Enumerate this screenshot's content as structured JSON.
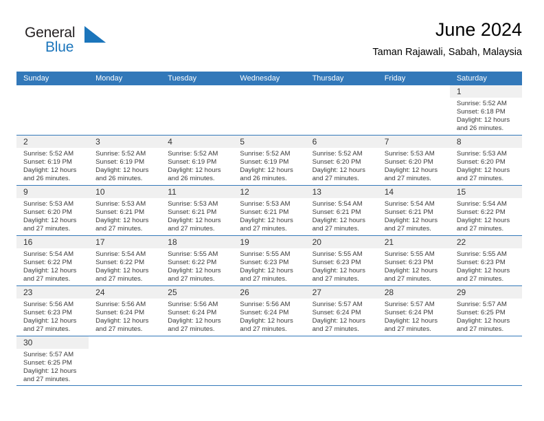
{
  "brand": {
    "name_part1": "General",
    "name_part2": "Blue",
    "mark": "triangle-logo-icon",
    "dark_color": "#231f20",
    "blue_color": "#1b75bb"
  },
  "header": {
    "title": "June 2024",
    "subtitle": "Taman Rajawali, Sabah, Malaysia"
  },
  "theme": {
    "header_blue": "#3278b9",
    "daynum_band": "#f0f0f0",
    "text": "#3a3a3a"
  },
  "weekday_headers": [
    "Sunday",
    "Monday",
    "Tuesday",
    "Wednesday",
    "Thursday",
    "Friday",
    "Saturday"
  ],
  "weeks": [
    [
      {
        "day": "",
        "empty": true,
        "sunrise": "",
        "sunset": "",
        "daylight1": "",
        "daylight2": ""
      },
      {
        "day": "",
        "empty": true,
        "sunrise": "",
        "sunset": "",
        "daylight1": "",
        "daylight2": ""
      },
      {
        "day": "",
        "empty": true,
        "sunrise": "",
        "sunset": "",
        "daylight1": "",
        "daylight2": ""
      },
      {
        "day": "",
        "empty": true,
        "sunrise": "",
        "sunset": "",
        "daylight1": "",
        "daylight2": ""
      },
      {
        "day": "",
        "empty": true,
        "sunrise": "",
        "sunset": "",
        "daylight1": "",
        "daylight2": ""
      },
      {
        "day": "",
        "empty": true,
        "sunrise": "",
        "sunset": "",
        "daylight1": "",
        "daylight2": ""
      },
      {
        "day": "1",
        "empty": false,
        "sunrise": "Sunrise: 5:52 AM",
        "sunset": "Sunset: 6:18 PM",
        "daylight1": "Daylight: 12 hours",
        "daylight2": "and 26 minutes."
      }
    ],
    [
      {
        "day": "2",
        "empty": false,
        "sunrise": "Sunrise: 5:52 AM",
        "sunset": "Sunset: 6:19 PM",
        "daylight1": "Daylight: 12 hours",
        "daylight2": "and 26 minutes."
      },
      {
        "day": "3",
        "empty": false,
        "sunrise": "Sunrise: 5:52 AM",
        "sunset": "Sunset: 6:19 PM",
        "daylight1": "Daylight: 12 hours",
        "daylight2": "and 26 minutes."
      },
      {
        "day": "4",
        "empty": false,
        "sunrise": "Sunrise: 5:52 AM",
        "sunset": "Sunset: 6:19 PM",
        "daylight1": "Daylight: 12 hours",
        "daylight2": "and 26 minutes."
      },
      {
        "day": "5",
        "empty": false,
        "sunrise": "Sunrise: 5:52 AM",
        "sunset": "Sunset: 6:19 PM",
        "daylight1": "Daylight: 12 hours",
        "daylight2": "and 26 minutes."
      },
      {
        "day": "6",
        "empty": false,
        "sunrise": "Sunrise: 5:52 AM",
        "sunset": "Sunset: 6:20 PM",
        "daylight1": "Daylight: 12 hours",
        "daylight2": "and 27 minutes."
      },
      {
        "day": "7",
        "empty": false,
        "sunrise": "Sunrise: 5:53 AM",
        "sunset": "Sunset: 6:20 PM",
        "daylight1": "Daylight: 12 hours",
        "daylight2": "and 27 minutes."
      },
      {
        "day": "8",
        "empty": false,
        "sunrise": "Sunrise: 5:53 AM",
        "sunset": "Sunset: 6:20 PM",
        "daylight1": "Daylight: 12 hours",
        "daylight2": "and 27 minutes."
      }
    ],
    [
      {
        "day": "9",
        "empty": false,
        "sunrise": "Sunrise: 5:53 AM",
        "sunset": "Sunset: 6:20 PM",
        "daylight1": "Daylight: 12 hours",
        "daylight2": "and 27 minutes."
      },
      {
        "day": "10",
        "empty": false,
        "sunrise": "Sunrise: 5:53 AM",
        "sunset": "Sunset: 6:21 PM",
        "daylight1": "Daylight: 12 hours",
        "daylight2": "and 27 minutes."
      },
      {
        "day": "11",
        "empty": false,
        "sunrise": "Sunrise: 5:53 AM",
        "sunset": "Sunset: 6:21 PM",
        "daylight1": "Daylight: 12 hours",
        "daylight2": "and 27 minutes."
      },
      {
        "day": "12",
        "empty": false,
        "sunrise": "Sunrise: 5:53 AM",
        "sunset": "Sunset: 6:21 PM",
        "daylight1": "Daylight: 12 hours",
        "daylight2": "and 27 minutes."
      },
      {
        "day": "13",
        "empty": false,
        "sunrise": "Sunrise: 5:54 AM",
        "sunset": "Sunset: 6:21 PM",
        "daylight1": "Daylight: 12 hours",
        "daylight2": "and 27 minutes."
      },
      {
        "day": "14",
        "empty": false,
        "sunrise": "Sunrise: 5:54 AM",
        "sunset": "Sunset: 6:21 PM",
        "daylight1": "Daylight: 12 hours",
        "daylight2": "and 27 minutes."
      },
      {
        "day": "15",
        "empty": false,
        "sunrise": "Sunrise: 5:54 AM",
        "sunset": "Sunset: 6:22 PM",
        "daylight1": "Daylight: 12 hours",
        "daylight2": "and 27 minutes."
      }
    ],
    [
      {
        "day": "16",
        "empty": false,
        "sunrise": "Sunrise: 5:54 AM",
        "sunset": "Sunset: 6:22 PM",
        "daylight1": "Daylight: 12 hours",
        "daylight2": "and 27 minutes."
      },
      {
        "day": "17",
        "empty": false,
        "sunrise": "Sunrise: 5:54 AM",
        "sunset": "Sunset: 6:22 PM",
        "daylight1": "Daylight: 12 hours",
        "daylight2": "and 27 minutes."
      },
      {
        "day": "18",
        "empty": false,
        "sunrise": "Sunrise: 5:55 AM",
        "sunset": "Sunset: 6:22 PM",
        "daylight1": "Daylight: 12 hours",
        "daylight2": "and 27 minutes."
      },
      {
        "day": "19",
        "empty": false,
        "sunrise": "Sunrise: 5:55 AM",
        "sunset": "Sunset: 6:23 PM",
        "daylight1": "Daylight: 12 hours",
        "daylight2": "and 27 minutes."
      },
      {
        "day": "20",
        "empty": false,
        "sunrise": "Sunrise: 5:55 AM",
        "sunset": "Sunset: 6:23 PM",
        "daylight1": "Daylight: 12 hours",
        "daylight2": "and 27 minutes."
      },
      {
        "day": "21",
        "empty": false,
        "sunrise": "Sunrise: 5:55 AM",
        "sunset": "Sunset: 6:23 PM",
        "daylight1": "Daylight: 12 hours",
        "daylight2": "and 27 minutes."
      },
      {
        "day": "22",
        "empty": false,
        "sunrise": "Sunrise: 5:55 AM",
        "sunset": "Sunset: 6:23 PM",
        "daylight1": "Daylight: 12 hours",
        "daylight2": "and 27 minutes."
      }
    ],
    [
      {
        "day": "23",
        "empty": false,
        "sunrise": "Sunrise: 5:56 AM",
        "sunset": "Sunset: 6:23 PM",
        "daylight1": "Daylight: 12 hours",
        "daylight2": "and 27 minutes."
      },
      {
        "day": "24",
        "empty": false,
        "sunrise": "Sunrise: 5:56 AM",
        "sunset": "Sunset: 6:24 PM",
        "daylight1": "Daylight: 12 hours",
        "daylight2": "and 27 minutes."
      },
      {
        "day": "25",
        "empty": false,
        "sunrise": "Sunrise: 5:56 AM",
        "sunset": "Sunset: 6:24 PM",
        "daylight1": "Daylight: 12 hours",
        "daylight2": "and 27 minutes."
      },
      {
        "day": "26",
        "empty": false,
        "sunrise": "Sunrise: 5:56 AM",
        "sunset": "Sunset: 6:24 PM",
        "daylight1": "Daylight: 12 hours",
        "daylight2": "and 27 minutes."
      },
      {
        "day": "27",
        "empty": false,
        "sunrise": "Sunrise: 5:57 AM",
        "sunset": "Sunset: 6:24 PM",
        "daylight1": "Daylight: 12 hours",
        "daylight2": "and 27 minutes."
      },
      {
        "day": "28",
        "empty": false,
        "sunrise": "Sunrise: 5:57 AM",
        "sunset": "Sunset: 6:24 PM",
        "daylight1": "Daylight: 12 hours",
        "daylight2": "and 27 minutes."
      },
      {
        "day": "29",
        "empty": false,
        "sunrise": "Sunrise: 5:57 AM",
        "sunset": "Sunset: 6:25 PM",
        "daylight1": "Daylight: 12 hours",
        "daylight2": "and 27 minutes."
      }
    ],
    [
      {
        "day": "30",
        "empty": false,
        "sunrise": "Sunrise: 5:57 AM",
        "sunset": "Sunset: 6:25 PM",
        "daylight1": "Daylight: 12 hours",
        "daylight2": "and 27 minutes."
      },
      {
        "day": "",
        "empty": true,
        "sunrise": "",
        "sunset": "",
        "daylight1": "",
        "daylight2": ""
      },
      {
        "day": "",
        "empty": true,
        "sunrise": "",
        "sunset": "",
        "daylight1": "",
        "daylight2": ""
      },
      {
        "day": "",
        "empty": true,
        "sunrise": "",
        "sunset": "",
        "daylight1": "",
        "daylight2": ""
      },
      {
        "day": "",
        "empty": true,
        "sunrise": "",
        "sunset": "",
        "daylight1": "",
        "daylight2": ""
      },
      {
        "day": "",
        "empty": true,
        "sunrise": "",
        "sunset": "",
        "daylight1": "",
        "daylight2": ""
      },
      {
        "day": "",
        "empty": true,
        "sunrise": "",
        "sunset": "",
        "daylight1": "",
        "daylight2": ""
      }
    ]
  ]
}
